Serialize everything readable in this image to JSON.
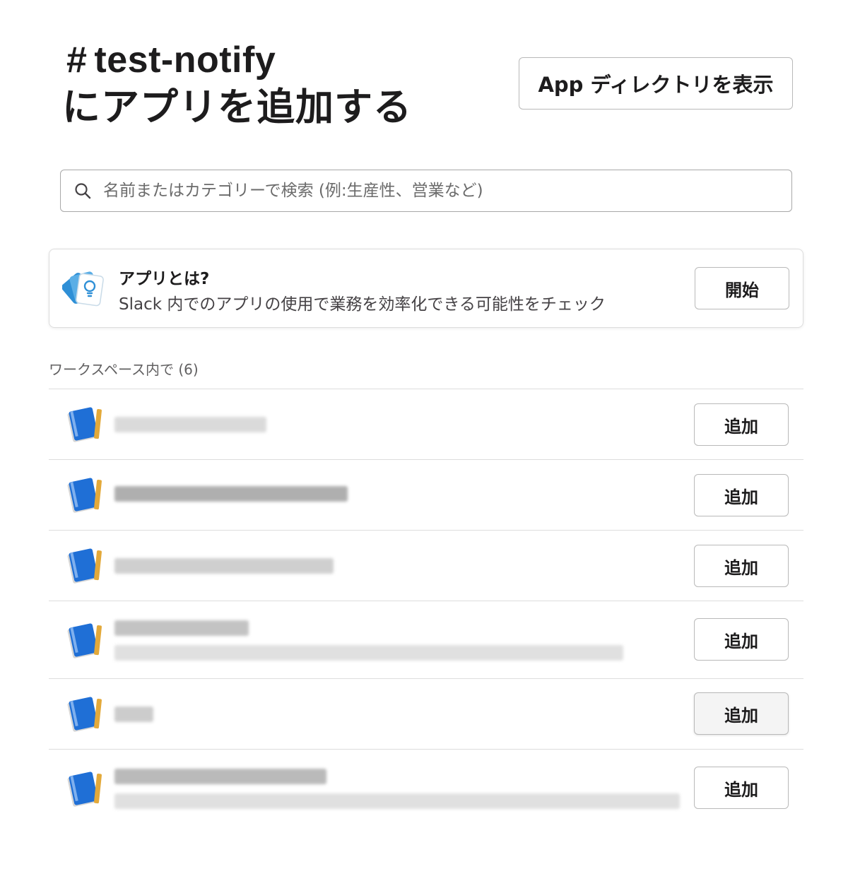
{
  "header": {
    "channel_hash": "#",
    "channel_name": "test-notify",
    "subtitle": "にアプリを追加する",
    "app_directory_label": "App ディレクトリを表示"
  },
  "search": {
    "placeholder": "名前またはカテゴリーで検索 (例:生産性、営業など)",
    "value": ""
  },
  "promo": {
    "title": "アプリとは?",
    "description": "Slack 内でのアプリの使用で業務を効率化できる可能性をチェック",
    "button_label": "開始",
    "icon": "lightbulb-cards-icon"
  },
  "workspace_section": {
    "header": "ワークスペース内で (6)",
    "apps": [
      {
        "icon": "app-notebook-icon",
        "button_label": "追加",
        "name_redacted": true,
        "has_description": false
      },
      {
        "icon": "app-notebook-icon",
        "button_label": "追加",
        "name_redacted": true,
        "has_description": false
      },
      {
        "icon": "app-notebook-icon",
        "button_label": "追加",
        "name_redacted": true,
        "has_description": false
      },
      {
        "icon": "app-notebook-icon",
        "button_label": "追加",
        "name_redacted": true,
        "has_description": true
      },
      {
        "icon": "app-notebook-icon",
        "button_label": "追加",
        "name_redacted": true,
        "has_description": false,
        "hovered": true
      },
      {
        "icon": "app-notebook-icon",
        "button_label": "追加",
        "name_redacted": true,
        "has_description": true
      }
    ]
  },
  "colors": {
    "text_primary": "#1d1c1d",
    "text_secondary": "#616061",
    "border": "#dddddd",
    "app_icon_blue": "#1f6fd6",
    "app_icon_gold": "#e3a93a",
    "promo_icon_blue": "#2e8fd6"
  }
}
